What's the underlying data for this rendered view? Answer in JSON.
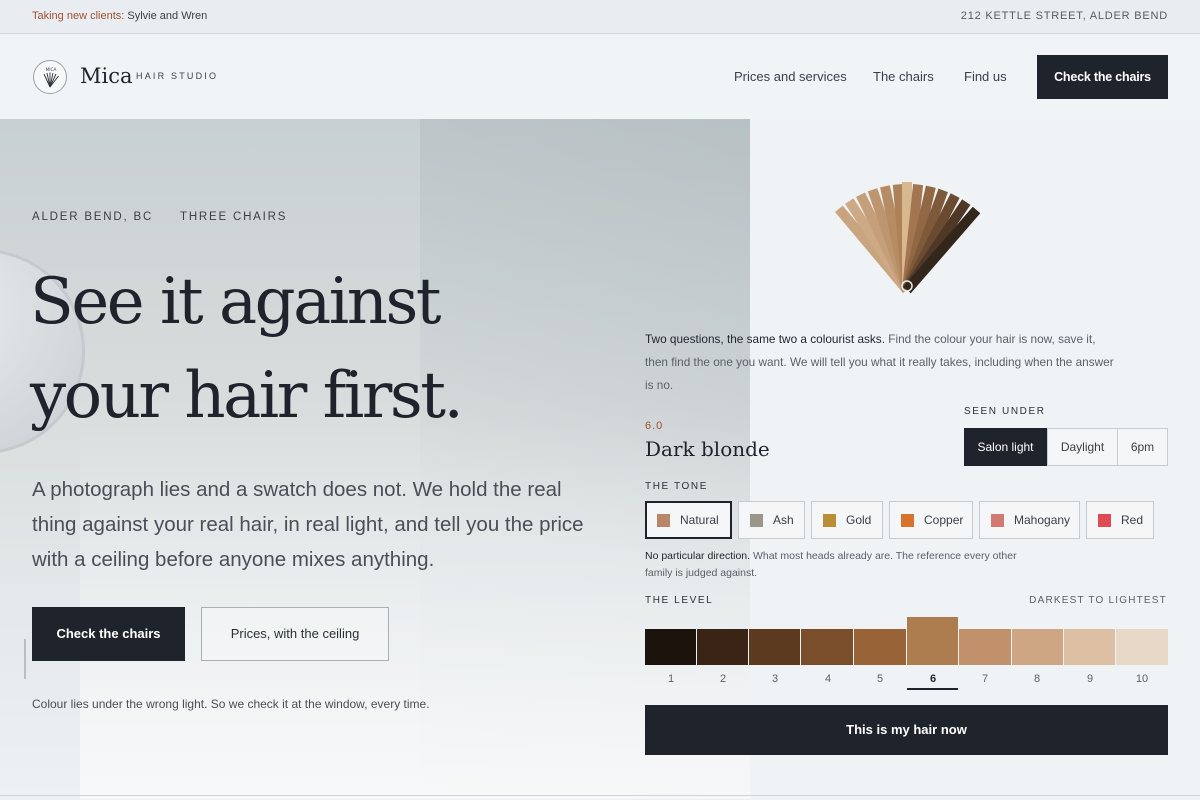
{
  "topbar": {
    "taking_label": "Taking new clients:",
    "taking_names": "Sylvie and Wren",
    "address": "212 KETTLE STREET, ALDER BEND"
  },
  "header": {
    "brand_name": "Mica",
    "brand_sub": "HAIR STUDIO",
    "logo_text": "MICA",
    "nav": [
      "Prices and services",
      "The chairs",
      "Find us"
    ],
    "cta": "Check the chairs"
  },
  "hero": {
    "eyebrow": [
      "ALDER BEND, BC",
      "THREE CHAIRS"
    ],
    "title": "See it against your hair first.",
    "body": "A photograph lies and a swatch does not. We hold the real thing against your real hair, in real light, and tell you the price with a ceiling before anyone mixes anything.",
    "primary_button": "Check the chairs",
    "secondary_button": "Prices, with the ceiling",
    "note": "Colour lies under the wrong light. So we check it at the window, every time."
  },
  "panel": {
    "intro_lead": "Two questions, the same two a colourist asks.",
    "intro_rest": "Find the colour your hair is now, save it, then find the one you want. We will tell you what it really takes, including when the answer is no.",
    "level_code": "6.0",
    "color_name": "Dark blonde",
    "seen_under_label": "SEEN UNDER",
    "seen_under_options": [
      "Salon light",
      "Daylight",
      "6pm"
    ],
    "seen_under_selected": "Salon light",
    "tone_label": "THE TONE",
    "tones": [
      {
        "label": "Natural",
        "color": "#b8876a"
      },
      {
        "label": "Ash",
        "color": "#9a968c"
      },
      {
        "label": "Gold",
        "color": "#b98e34"
      },
      {
        "label": "Copper",
        "color": "#d8732c"
      },
      {
        "label": "Mahogany",
        "color": "#d27a72"
      },
      {
        "label": "Red",
        "color": "#e04a54"
      }
    ],
    "tone_selected": "Natural",
    "tone_desc_lead": "No particular direction.",
    "tone_desc_rest": "What most heads already are. The reference every other family is judged against.",
    "level_label": "THE LEVEL",
    "level_range": "DARKEST TO LIGHTEST",
    "levels": [
      {
        "num": "1",
        "color": "#1c130d"
      },
      {
        "num": "2",
        "color": "#3a2415"
      },
      {
        "num": "3",
        "color": "#5c3a1f"
      },
      {
        "num": "4",
        "color": "#7a4e2a"
      },
      {
        "num": "5",
        "color": "#986437"
      },
      {
        "num": "6",
        "color": "#ad7c4f"
      },
      {
        "num": "7",
        "color": "#c0916a"
      },
      {
        "num": "8",
        "color": "#cfa684"
      },
      {
        "num": "9",
        "color": "#ddbfa3"
      },
      {
        "num": "10",
        "color": "#e8d8c8"
      }
    ],
    "level_selected": "6",
    "submit": "This is my hair now"
  }
}
